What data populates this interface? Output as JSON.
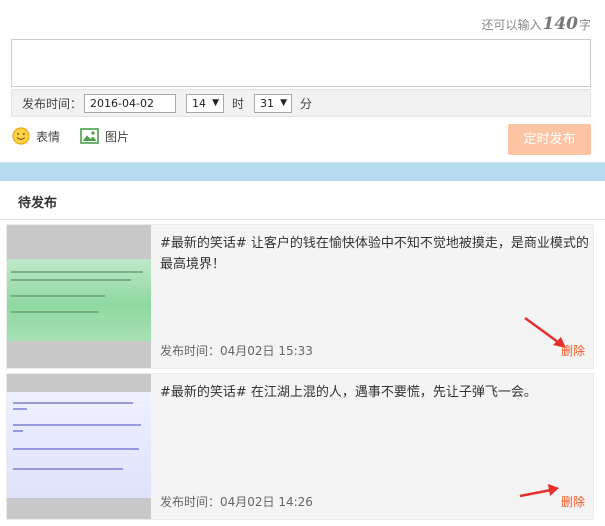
{
  "composer": {
    "remaining_prefix": "还可以输入",
    "remaining_count": "140",
    "remaining_suffix": "字",
    "schedule_label": "发布时间：",
    "date_value": "2016-04-02",
    "hour_value": "14",
    "hour_unit": "时",
    "minute_value": "31",
    "minute_unit": "分",
    "emoji_label": "表情",
    "image_label": "图片",
    "submit_label": "定时发布"
  },
  "pending": {
    "title": "待发布",
    "items": [
      {
        "text": "#最新的笑话# 让客户的钱在愉快体验中不知不觉地被摸走，是商业模式的最高境界！",
        "time": "发布时间：04月02日 15:33",
        "delete_label": "删除"
      },
      {
        "text": "#最新的笑话# 在江湖上混的人，遇事不要慌，先让子弹飞一会。",
        "time": "发布时间：04月02日 14:26",
        "delete_label": "删除"
      }
    ]
  },
  "colors": {
    "accent_orange": "#fcc4a3",
    "delete_red": "#f0592a",
    "page_bg": "#b9dbef"
  },
  "icons": [
    "emoji-icon",
    "image-icon",
    "dropdown-arrow-icon",
    "annotation-arrow-icon"
  ]
}
